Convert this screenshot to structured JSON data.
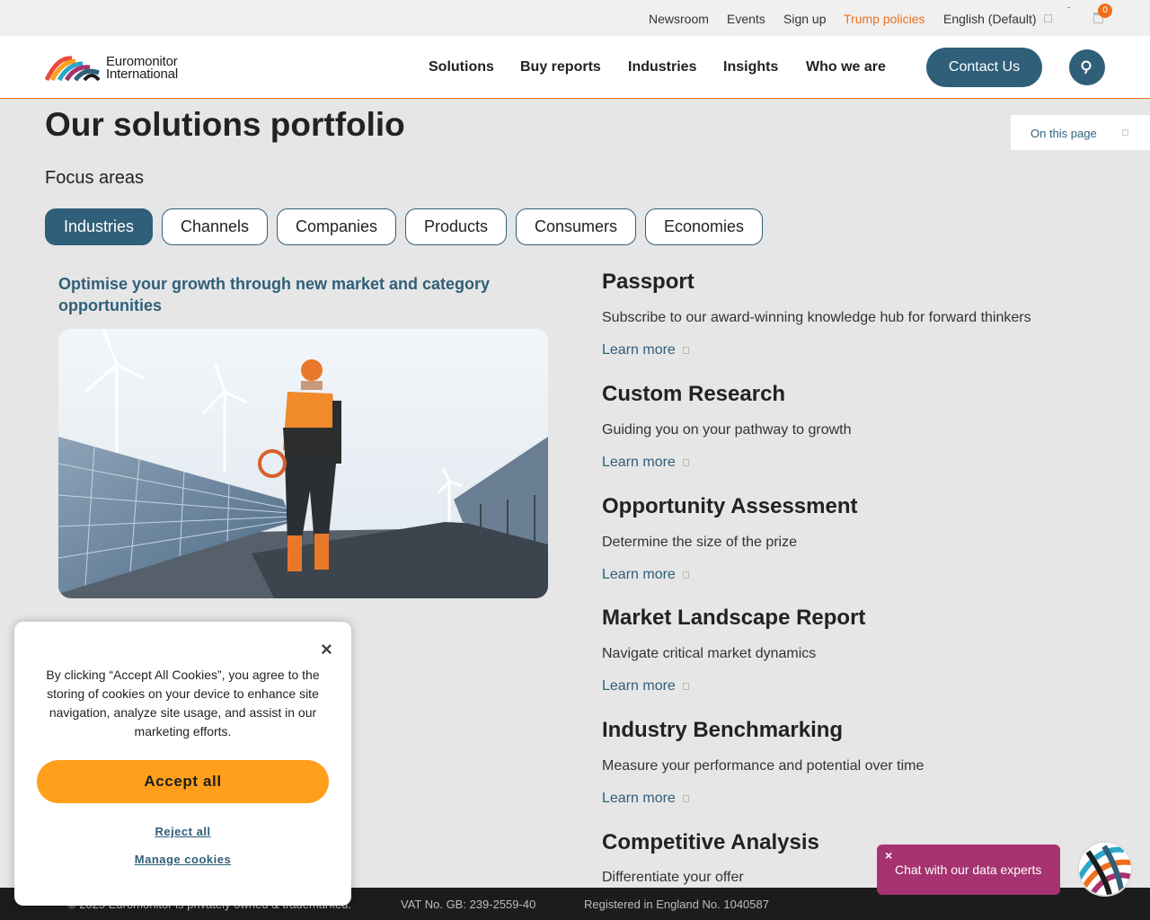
{
  "topbar": {
    "links": [
      "Newsroom",
      "Events",
      "Sign up"
    ],
    "highlight": "Trump policies",
    "language": "English (Default)",
    "cart_count": "0"
  },
  "header": {
    "logo_line1": "Euromonitor",
    "logo_line2": "International",
    "nav": [
      "Solutions",
      "Buy reports",
      "Industries",
      "Insights",
      "Who we are"
    ],
    "contact": "Contact Us"
  },
  "onpage": {
    "label": "On this page"
  },
  "page": {
    "title": "Our solutions portfolio",
    "focus_label": "Focus areas",
    "pills": [
      "Industries",
      "Channels",
      "Companies",
      "Products",
      "Consumers",
      "Economies"
    ],
    "active_pill": "Industries",
    "tagline": "Optimise your growth through new market and category opportunities"
  },
  "solutions": [
    {
      "title": "Passport",
      "desc": "Subscribe to our award-winning knowledge hub for forward thinkers",
      "link": "Learn more"
    },
    {
      "title": "Custom Research",
      "desc": "Guiding you on your pathway to growth",
      "link": "Learn more"
    },
    {
      "title": "Opportunity Assessment",
      "desc": "Determine the size of the prize",
      "link": "Learn more"
    },
    {
      "title": "Market Landscape Report",
      "desc": "Navigate critical market dynamics",
      "link": "Learn more"
    },
    {
      "title": "Industry Benchmarking",
      "desc": "Measure your performance and potential over time",
      "link": "Learn more"
    },
    {
      "title": "Competitive Analysis",
      "desc": "Differentiate your offer",
      "link": ""
    }
  ],
  "footer": {
    "copyright": "© 2025 Euromonitor is privately owned & trademarked.",
    "vat": "VAT No. GB: 239-2559-40",
    "registered": "Registered in England No. 1040587"
  },
  "cookie": {
    "close": "×",
    "text": "By clicking “Accept All Cookies”, you agree to the storing of cookies on your device to enhance site navigation, analyze site usage, and assist in our marketing efforts.",
    "accept": "Accept all",
    "reject": "Reject all",
    "manage": "Manage cookies"
  },
  "chat": {
    "close": "×",
    "text": "Chat with our data experts"
  },
  "colors": {
    "brand": "#2f5f79",
    "accent": "#ef6f1b",
    "accept": "#ff9f1c",
    "chat": "#a6336f"
  }
}
